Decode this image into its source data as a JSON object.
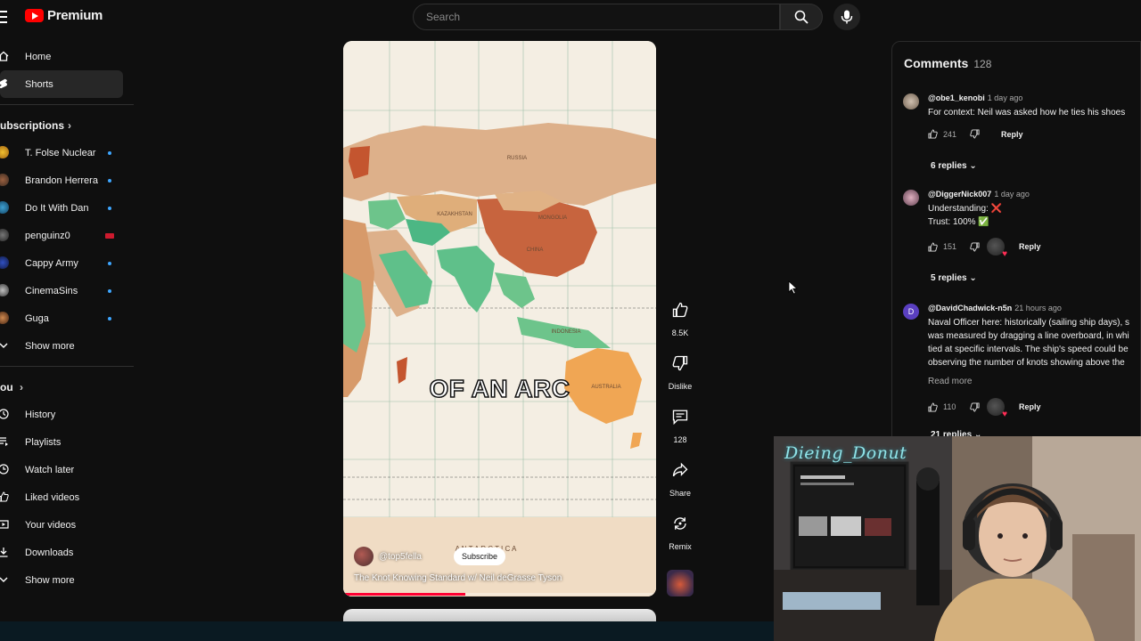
{
  "header": {
    "logo_text": "Premium",
    "search_placeholder": "Search"
  },
  "sidebar": {
    "main": [
      {
        "label": "Home",
        "icon": "home-icon"
      },
      {
        "label": "Shorts",
        "icon": "shorts-icon",
        "active": true
      }
    ],
    "subscriptions_title": "ubscriptions",
    "subscriptions": [
      {
        "label": "T. Folse Nuclear",
        "indicator": "dot"
      },
      {
        "label": "Brandon Herrera",
        "indicator": "dot"
      },
      {
        "label": "Do It With Dan",
        "indicator": "dot"
      },
      {
        "label": "penguinz0",
        "indicator": "live"
      },
      {
        "label": "Cappy Army",
        "indicator": "dot"
      },
      {
        "label": "CinemaSins",
        "indicator": "dot"
      },
      {
        "label": "Guga",
        "indicator": "dot"
      }
    ],
    "subs_show_more": "Show more",
    "you_title": "ou",
    "you_items": [
      {
        "label": "History",
        "icon": "history-icon"
      },
      {
        "label": "Playlists",
        "icon": "playlists-icon"
      },
      {
        "label": "Watch later",
        "icon": "watch-later-icon"
      },
      {
        "label": "Liked videos",
        "icon": "thumbs-up-icon"
      },
      {
        "label": "Your videos",
        "icon": "your-videos-icon"
      },
      {
        "label": "Downloads",
        "icon": "download-icon"
      }
    ],
    "you_show_more": "Show more"
  },
  "short": {
    "caption": "OF AN ARC",
    "channel": "@top5fella",
    "subscribe_label": "Subscribe",
    "title": "The Knot Knowing Standard w/ Neil deGrasse Tyson",
    "progress": 0.39,
    "map_labels": [
      "RUSSIA",
      "KAZAKHSTAN",
      "MONGOLIA",
      "CHINA",
      "INDONESIA",
      "AUSTRALIA",
      "A N T A R C T I C A"
    ]
  },
  "actions": {
    "like_count": "8.5K",
    "dislike_label": "Dislike",
    "comment_count": "128",
    "share_label": "Share",
    "remix_label": "Remix"
  },
  "comments": {
    "title": "Comments",
    "count": "128",
    "items": [
      {
        "user": "@obe1_kenobi",
        "time": "1 day ago",
        "lines": [
          "For context: Neil was asked how he ties his shoes"
        ],
        "likes": "241",
        "reply_label": "Reply",
        "replies": "6 replies",
        "hearted": false
      },
      {
        "user": "@DiggerNick007",
        "time": "1 day ago",
        "lines": [
          "Understanding: ❌",
          "Trust: 100% ✅"
        ],
        "likes": "151",
        "reply_label": "Reply",
        "replies": "5 replies",
        "hearted": true
      },
      {
        "user": "@DavidChadwick-n5n",
        "time": "21 hours ago",
        "lines": [
          "Naval Officer here: historically (sailing ship days), s",
          "was measured by dragging a line overboard, in whi",
          "tied at specific intervals. The ship's speed could be",
          "observing the number of knots showing above the"
        ],
        "read_more": "Read more",
        "likes": "110",
        "reply_label": "Reply",
        "replies": "21 replies",
        "hearted": true
      }
    ]
  },
  "webcam": {
    "name": "Dieing_Donut"
  }
}
